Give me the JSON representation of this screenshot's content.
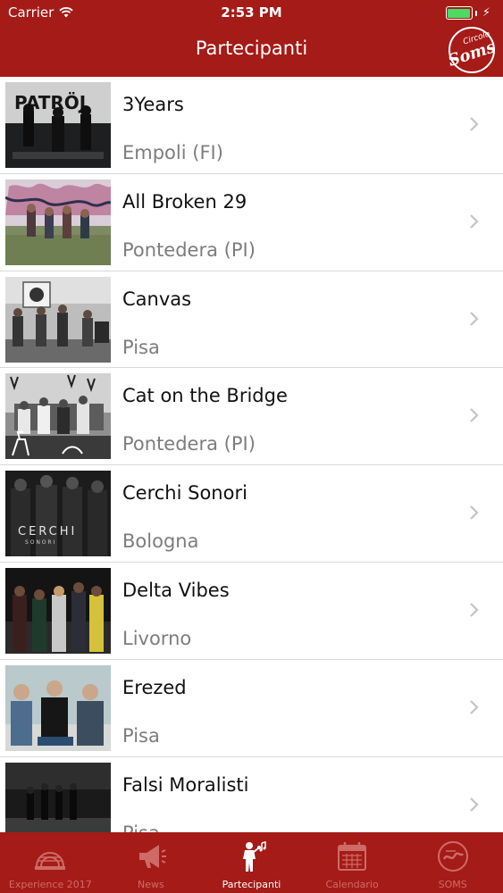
{
  "status_bar": {
    "carrier": "Carrier",
    "time": "2:53 PM"
  },
  "nav": {
    "title": "Partecipanti",
    "logo_top": "Circolo",
    "logo_main": "Soms"
  },
  "bands": [
    {
      "name": "3Years",
      "city": "Empoli (FI)"
    },
    {
      "name": "All Broken 29",
      "city": "Pontedera (PI)"
    },
    {
      "name": "Canvas",
      "city": "Pisa"
    },
    {
      "name": "Cat on the Bridge",
      "city": "Pontedera (PI)"
    },
    {
      "name": "Cerchi Sonori",
      "city": "Bologna"
    },
    {
      "name": "Delta Vibes",
      "city": "Livorno"
    },
    {
      "name": "Erezed",
      "city": "Pisa"
    },
    {
      "name": "Falsi Moralisti",
      "city": "Pisa"
    }
  ],
  "thumb_texts": {
    "patrojo": "PATRÖJ",
    "cerchi": "CERCHI",
    "sonori": "S O N O R I"
  },
  "tabs": [
    {
      "label": "Experience 2017",
      "icon": "stage-icon",
      "active": false
    },
    {
      "label": "News",
      "icon": "megaphone-icon",
      "active": false
    },
    {
      "label": "Partecipanti",
      "icon": "singer-icon",
      "active": true
    },
    {
      "label": "Calendario",
      "icon": "calendar-icon",
      "active": false
    },
    {
      "label": "SOMS",
      "icon": "soms-logo-icon",
      "active": false
    }
  ],
  "colors": {
    "brand": "#a51b17",
    "battery": "#4cd964",
    "tab_inactive": "#cf6b67",
    "secondary_text": "#7d7d7d"
  }
}
